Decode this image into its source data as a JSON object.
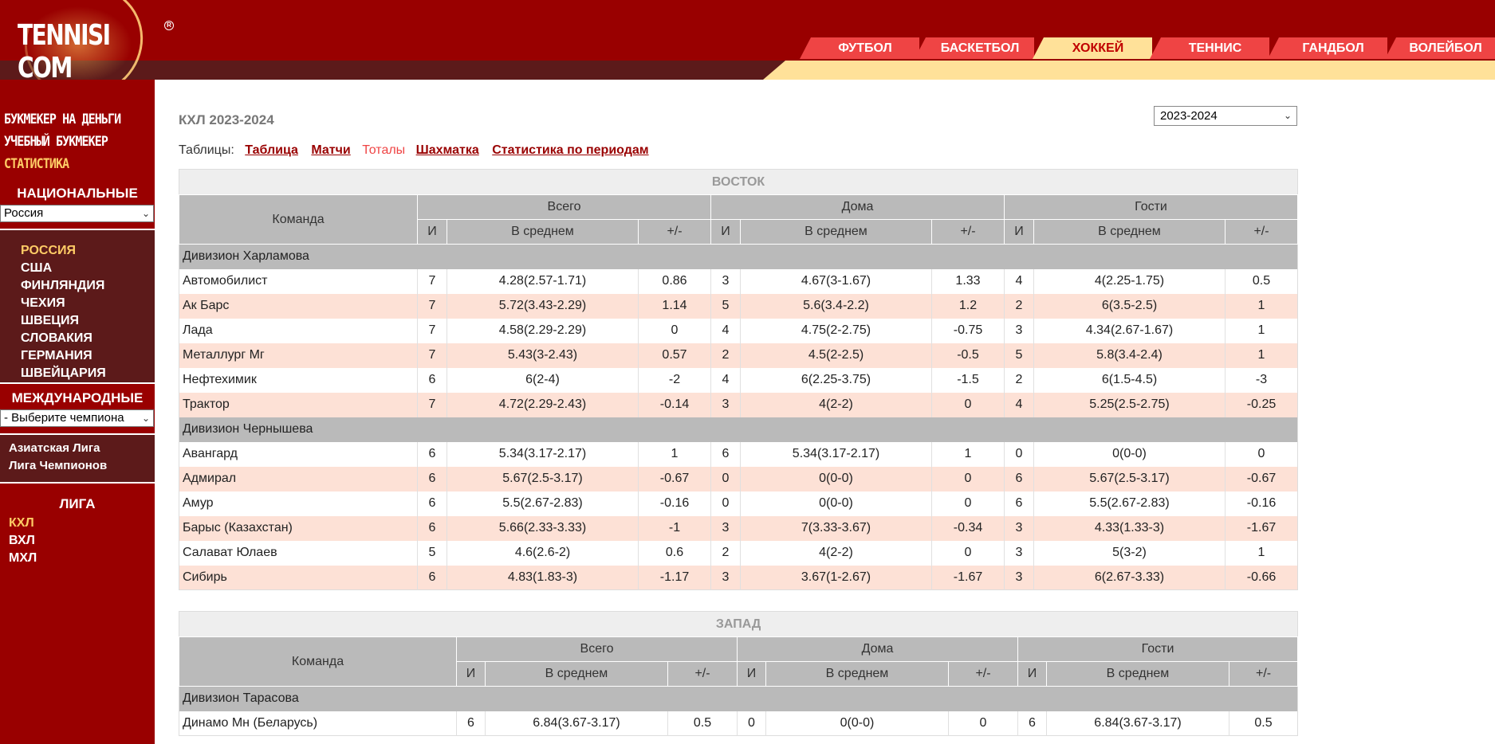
{
  "header": {
    "logo_text": "TENNISI COM",
    "logo_reg": "R",
    "nav_tabs": [
      {
        "label": "ФУТБОЛ"
      },
      {
        "label": "БАСКЕТБОЛ"
      },
      {
        "label": "ХОККЕЙ",
        "active": true
      },
      {
        "label": "ТЕННИС"
      },
      {
        "label": "ГАНДБОЛ"
      },
      {
        "label": "ВОЛЕЙБОЛ"
      }
    ]
  },
  "sidebar": {
    "promo_links": [
      "БУКМЕКЕР НА ДЕНЬГИ",
      "УЧЕБНЫЙ БУКМЕКЕР",
      "СТАТИСТИКА"
    ],
    "national_heading": "НАЦИОНАЛЬНЫЕ",
    "national_select": "Россия",
    "countries": [
      "РОССИЯ",
      "США",
      "ФИНЛЯНДИЯ",
      "ЧЕХИЯ",
      "ШВЕЦИЯ",
      "СЛОВАКИЯ",
      "ГЕРМАНИЯ",
      "ШВЕЙЦАРИЯ"
    ],
    "international_heading": "МЕЖДУНАРОДНЫЕ",
    "international_select": "- Выберите чемпиона",
    "international_links": [
      "Азиатская Лига",
      "Лига Чемпионов"
    ],
    "league_heading": "ЛИГА",
    "leagues": [
      "КХЛ",
      "ВХЛ",
      "МХЛ"
    ]
  },
  "main": {
    "title": "КХЛ 2023-2024",
    "season_select": "2023-2024",
    "tables_label": "Таблицы:",
    "tables_links": [
      "Таблица",
      "Матчи",
      "Тоталы",
      "Шахматка",
      "Статистика по периодам"
    ],
    "tables_current": "Тоталы",
    "headers": {
      "team": "Команда",
      "total": "Всего",
      "home": "Дома",
      "away": "Гости",
      "games": "И",
      "average": "В среднем",
      "diff": "+/-"
    },
    "conferences": [
      {
        "name": "ВОСТОК",
        "divisions": [
          {
            "name": "Дивизион Харламова",
            "rows": [
              [
                "Автомобилист",
                "7",
                "4.28(2.57-1.71)",
                "0.86",
                "3",
                "4.67(3-1.67)",
                "1.33",
                "4",
                "4(2.25-1.75)",
                "0.5"
              ],
              [
                "Ак Барс",
                "7",
                "5.72(3.43-2.29)",
                "1.14",
                "5",
                "5.6(3.4-2.2)",
                "1.2",
                "2",
                "6(3.5-2.5)",
                "1"
              ],
              [
                "Лада",
                "7",
                "4.58(2.29-2.29)",
                "0",
                "4",
                "4.75(2-2.75)",
                "-0.75",
                "3",
                "4.34(2.67-1.67)",
                "1"
              ],
              [
                "Металлург Мг",
                "7",
                "5.43(3-2.43)",
                "0.57",
                "2",
                "4.5(2-2.5)",
                "-0.5",
                "5",
                "5.8(3.4-2.4)",
                "1"
              ],
              [
                "Нефтехимик",
                "6",
                "6(2-4)",
                "-2",
                "4",
                "6(2.25-3.75)",
                "-1.5",
                "2",
                "6(1.5-4.5)",
                "-3"
              ],
              [
                "Трактор",
                "7",
                "4.72(2.29-2.43)",
                "-0.14",
                "3",
                "4(2-2)",
                "0",
                "4",
                "5.25(2.5-2.75)",
                "-0.25"
              ]
            ]
          },
          {
            "name": "Дивизион Чернышева",
            "rows": [
              [
                "Авангард",
                "6",
                "5.34(3.17-2.17)",
                "1",
                "6",
                "5.34(3.17-2.17)",
                "1",
                "0",
                "0(0-0)",
                "0"
              ],
              [
                "Адмирал",
                "6",
                "5.67(2.5-3.17)",
                "-0.67",
                "0",
                "0(0-0)",
                "0",
                "6",
                "5.67(2.5-3.17)",
                "-0.67"
              ],
              [
                "Амур",
                "6",
                "5.5(2.67-2.83)",
                "-0.16",
                "0",
                "0(0-0)",
                "0",
                "6",
                "5.5(2.67-2.83)",
                "-0.16"
              ],
              [
                "Барыс (Казахстан)",
                "6",
                "5.66(2.33-3.33)",
                "-1",
                "3",
                "7(3.33-3.67)",
                "-0.34",
                "3",
                "4.33(1.33-3)",
                "-1.67"
              ],
              [
                "Салават Юлаев",
                "5",
                "4.6(2.6-2)",
                "0.6",
                "2",
                "4(2-2)",
                "0",
                "3",
                "5(3-2)",
                "1"
              ],
              [
                "Сибирь",
                "6",
                "4.83(1.83-3)",
                "-1.17",
                "3",
                "3.67(1-2.67)",
                "-1.67",
                "3",
                "6(2.67-3.33)",
                "-0.66"
              ]
            ]
          }
        ]
      },
      {
        "name": "ЗАПАД",
        "divisions": [
          {
            "name": "Дивизион Тарасова",
            "rows": [
              [
                "Динамо Мн (Беларусь)",
                "6",
                "6.84(3.67-3.17)",
                "0.5",
                "0",
                "0(0-0)",
                "0",
                "6",
                "6.84(3.67-3.17)",
                "0.5"
              ]
            ]
          }
        ]
      }
    ]
  }
}
